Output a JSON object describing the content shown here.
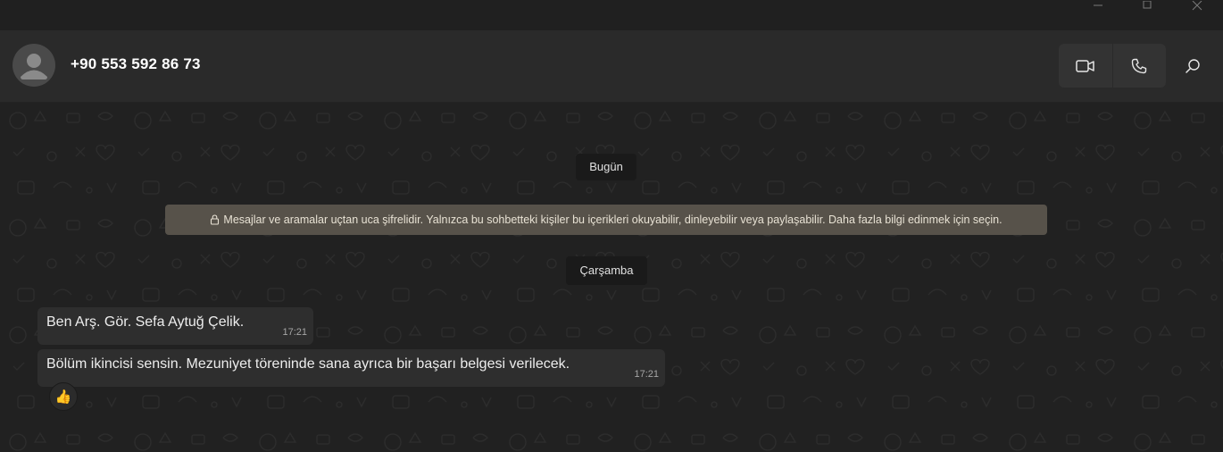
{
  "window": {
    "controls": [
      "minimize-icon",
      "maximize-icon",
      "close-icon"
    ]
  },
  "header": {
    "contact_name": "+90 553 592 86 73",
    "icons": [
      "avatar-placeholder-icon",
      "video-call-icon",
      "voice-call-icon",
      "search-icon"
    ]
  },
  "chat": {
    "date_today": "Bugün",
    "encryption_notice": "Mesajlar ve aramalar uçtan uca şifrelidir. Yalnızca bu sohbetteki kişiler bu içerikleri okuyabilir, dinleyebilir veya paylaşabilir. Daha fazla bilgi edinmek için seçin.",
    "date_separator": "Çarşamba",
    "messages": [
      {
        "text": "Ben Arş. Gör. Sefa Aytuğ Çelik.",
        "time": "17:21"
      },
      {
        "text": "Bölüm ikincisi sensin. Mezuniyet töreninde sana ayrıca bir başarı belgesi verilecek.",
        "time": "17:21",
        "reaction": "👍"
      }
    ]
  },
  "colors": {
    "background": "#212121",
    "header": "#2a2a2a",
    "bubble": "#2e2e2e",
    "encryption_banner": "#57524a"
  }
}
